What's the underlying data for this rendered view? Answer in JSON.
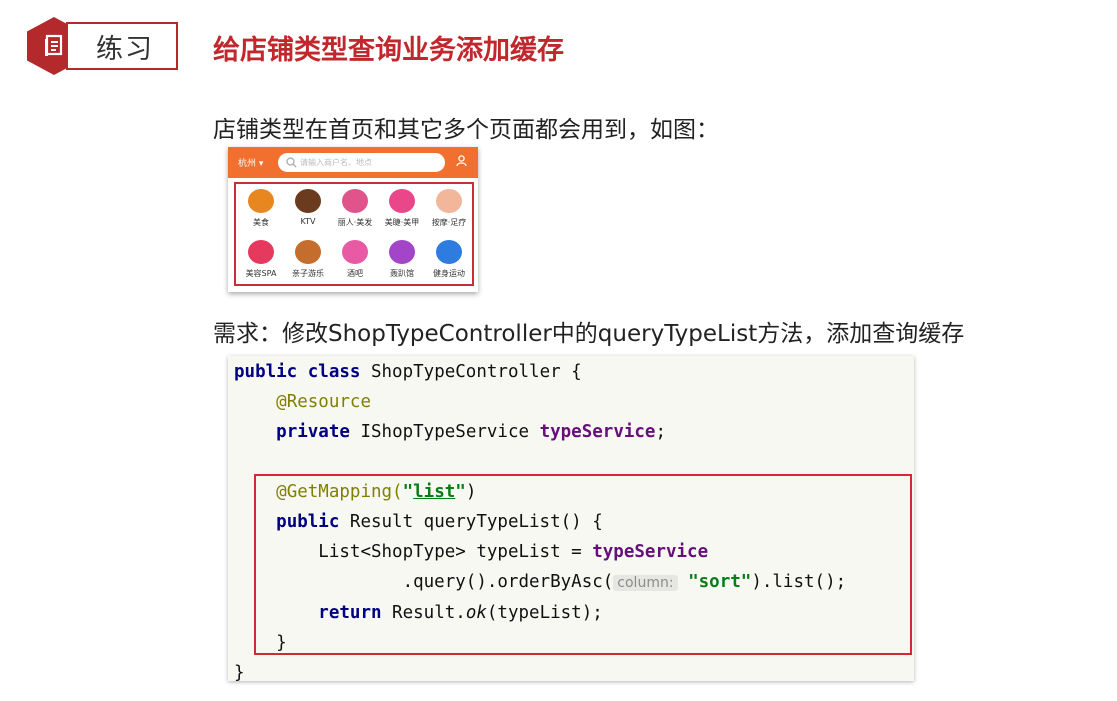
{
  "header": {
    "tag_icon": "document-icon",
    "tag_label": "练习",
    "title": "给店铺类型查询业务添加缓存"
  },
  "body": {
    "line1": "店铺类型在首页和其它多个页面都会用到，如图：",
    "line2": "需求：修改ShopTypeController中的queryTypeList方法，添加查询缓存"
  },
  "phone": {
    "city": "杭州 ▾",
    "search_placeholder": "请输入商户名、地点",
    "user_icon": "user-icon",
    "categories": [
      {
        "label": "美食",
        "color": "#e8861f",
        "glyph": "🍗"
      },
      {
        "label": "KTV",
        "color": "#6a3b1f",
        "glyph": "🎤"
      },
      {
        "label": "丽人·美发",
        "color": "#e0548b",
        "glyph": "💇"
      },
      {
        "label": "美睫·美甲",
        "color": "#e9478a",
        "glyph": "💅"
      },
      {
        "label": "按摩·足疗",
        "color": "#f2b69a",
        "glyph": "🦶"
      },
      {
        "label": "美容SPA",
        "color": "#e53a5e",
        "glyph": "💆"
      },
      {
        "label": "亲子游乐",
        "color": "#c46d2c",
        "glyph": "🧸"
      },
      {
        "label": "酒吧",
        "color": "#e85aa3",
        "glyph": "🍸"
      },
      {
        "label": "轰趴馆",
        "color": "#a245c9",
        "glyph": "🎭"
      },
      {
        "label": "健身运动",
        "color": "#2f7ce0",
        "glyph": "🏋"
      }
    ]
  },
  "code": {
    "l1_kw1": "public",
    "l1_kw2": "class",
    "l1_rest": " ShopTypeController {",
    "l2_ann": "@Resource",
    "l3_kw": "private",
    "l3_type": " IShopTypeService ",
    "l3_field": "typeService",
    "l3_end": ";",
    "l5_ann": "@GetMapping(",
    "l5_q1": "\"",
    "l5_str": "list",
    "l5_q2": "\"",
    "l5_end": ")",
    "l6_kw": "public",
    "l6_rest": " Result queryTypeList() {",
    "l7_pre": "List<ShopType> typeList = ",
    "l7_field": "typeService",
    "l8_pre": ".query().orderByAsc(",
    "l8_hint": "column:",
    "l8_str": "\"sort\"",
    "l8_end": ").list();",
    "l9_kw": "return",
    "l9_mid": " Result.",
    "l9_it": "ok",
    "l9_end": "(typeList);",
    "l10": "}",
    "l11": "}"
  }
}
